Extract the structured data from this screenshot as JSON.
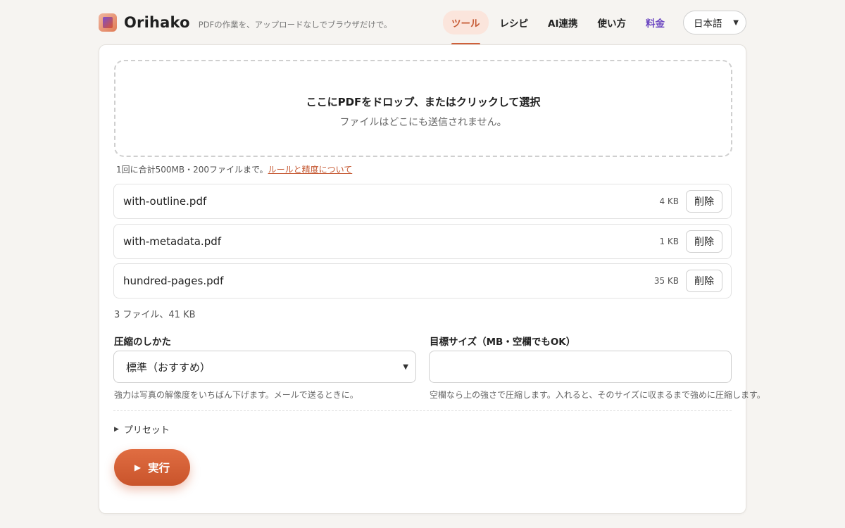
{
  "header": {
    "brand": "Orihako",
    "tagline": "PDFの作業を、アップロードなしでブラウザだけで。",
    "nav": [
      {
        "label": "ツール"
      },
      {
        "label": "レシピ"
      },
      {
        "label": "AI連携"
      },
      {
        "label": "使い方"
      },
      {
        "label": "料金"
      }
    ],
    "language": "日本語"
  },
  "dropzone": {
    "title": "ここにPDFをドロップ、またはクリックして選択",
    "subtitle": "ファイルはどこにも送信されません。"
  },
  "limits": {
    "text": "1回に合計500MB・200ファイルまで。",
    "link": "ルールと精度について"
  },
  "files": [
    {
      "name": "with-outline.pdf",
      "size": "4 KB",
      "delete_label": "削除"
    },
    {
      "name": "with-metadata.pdf",
      "size": "1 KB",
      "delete_label": "削除"
    },
    {
      "name": "hundred-pages.pdf",
      "size": "35 KB",
      "delete_label": "削除"
    }
  ],
  "summary": "3 ファイル、41 KB",
  "compression": {
    "label": "圧縮のしかた",
    "selected": "標準（おすすめ）",
    "hint": "強力は写真の解像度をいちばん下げます。メールで送るときに。"
  },
  "target_size": {
    "label": "目標サイズ（MB・空欄でもOK）",
    "value": "",
    "hint": "空欄なら上の強さで圧縮します。入れると、そのサイズに収まるまで強めに圧縮します。"
  },
  "preset_label": "プリセット",
  "run_label": "実行",
  "colors": {
    "accent": "#d0603a",
    "pricing": "#6b46c1",
    "active_bg": "#fbe5dc"
  }
}
